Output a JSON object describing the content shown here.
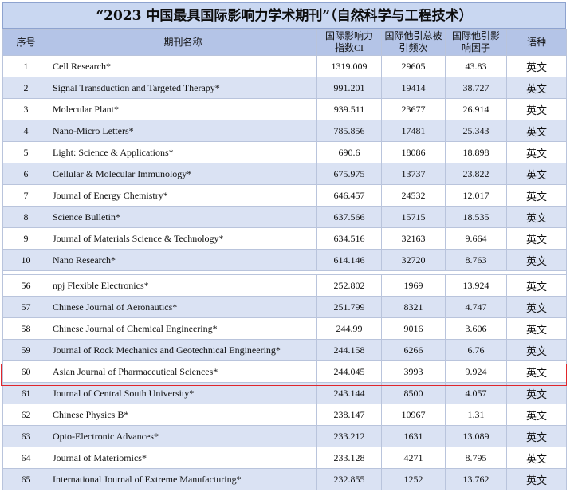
{
  "title": "“2023 中国最具国际影响力学术期刊”（自然科学与工程技术）",
  "headers": {
    "seq": "序号",
    "name": "期刊名称",
    "ci": [
      "国际影响力",
      "指数CI"
    ],
    "cites": [
      "国际他引总被",
      "引频次"
    ],
    "if": [
      "国际他引影",
      "响因子"
    ],
    "lang": "语种"
  },
  "rows_top": [
    {
      "seq": "1",
      "name": "Cell Research*",
      "ci": "1319.009",
      "cites": "29605",
      "if": "43.83",
      "lang": "英文"
    },
    {
      "seq": "2",
      "name": "Signal Transduction and Targeted Therapy*",
      "ci": "991.201",
      "cites": "19414",
      "if": "38.727",
      "lang": "英文"
    },
    {
      "seq": "3",
      "name": "Molecular Plant*",
      "ci": "939.511",
      "cites": "23677",
      "if": "26.914",
      "lang": "英文"
    },
    {
      "seq": "4",
      "name": "Nano-Micro Letters*",
      "ci": "785.856",
      "cites": "17481",
      "if": "25.343",
      "lang": "英文"
    },
    {
      "seq": "5",
      "name": "Light: Science & Applications*",
      "ci": "690.6",
      "cites": "18086",
      "if": "18.898",
      "lang": "英文"
    },
    {
      "seq": "6",
      "name": "Cellular & Molecular Immunology*",
      "ci": "675.975",
      "cites": "13737",
      "if": "23.822",
      "lang": "英文"
    },
    {
      "seq": "7",
      "name": "Journal of Energy Chemistry*",
      "ci": "646.457",
      "cites": "24532",
      "if": "12.017",
      "lang": "英文"
    },
    {
      "seq": "8",
      "name": "Science Bulletin*",
      "ci": "637.566",
      "cites": "15715",
      "if": "18.535",
      "lang": "英文"
    },
    {
      "seq": "9",
      "name": "Journal of Materials Science & Technology*",
      "ci": "634.516",
      "cites": "32163",
      "if": "9.664",
      "lang": "英文"
    },
    {
      "seq": "10",
      "name": "Nano Research*",
      "ci": "614.146",
      "cites": "32720",
      "if": "8.763",
      "lang": "英文"
    }
  ],
  "rows_bottom": [
    {
      "seq": "56",
      "name": "npj Flexible Electronics*",
      "ci": "252.802",
      "cites": "1969",
      "if": "13.924",
      "lang": "英文"
    },
    {
      "seq": "57",
      "name": "Chinese Journal of Aeronautics*",
      "ci": "251.799",
      "cites": "8321",
      "if": "4.747",
      "lang": "英文"
    },
    {
      "seq": "58",
      "name": "Chinese Journal of Chemical Engineering*",
      "ci": "244.99",
      "cites": "9016",
      "if": "3.606",
      "lang": "英文"
    },
    {
      "seq": "59",
      "name": "Journal of Rock Mechanics and Geotechnical Engineering*",
      "ci": "244.158",
      "cites": "6266",
      "if": "6.76",
      "lang": "英文"
    },
    {
      "seq": "60",
      "name": "Asian Journal of Pharmaceutical Sciences*",
      "ci": "244.045",
      "cites": "3993",
      "if": "9.924",
      "lang": "英文"
    },
    {
      "seq": "61",
      "name": "Journal of Central South University*",
      "ci": "243.144",
      "cites": "8500",
      "if": "4.057",
      "lang": "英文"
    },
    {
      "seq": "62",
      "name": "Chinese Physics B*",
      "ci": "238.147",
      "cites": "10967",
      "if": "1.31",
      "lang": "英文"
    },
    {
      "seq": "63",
      "name": "Opto-Electronic Advances*",
      "ci": "233.212",
      "cites": "1631",
      "if": "13.089",
      "lang": "英文"
    },
    {
      "seq": "64",
      "name": "Journal of Materiomics*",
      "ci": "233.128",
      "cites": "4271",
      "if": "8.795",
      "lang": "英文"
    },
    {
      "seq": "65",
      "name": "International Journal of Extreme Manufacturing*",
      "ci": "232.855",
      "cites": "1252",
      "if": "13.762",
      "lang": "英文"
    }
  ],
  "colors": {
    "header": "#b4c4e7",
    "title": "#c9d7f1",
    "stripe": "#dae2f3",
    "highlight": "#e1262b"
  }
}
